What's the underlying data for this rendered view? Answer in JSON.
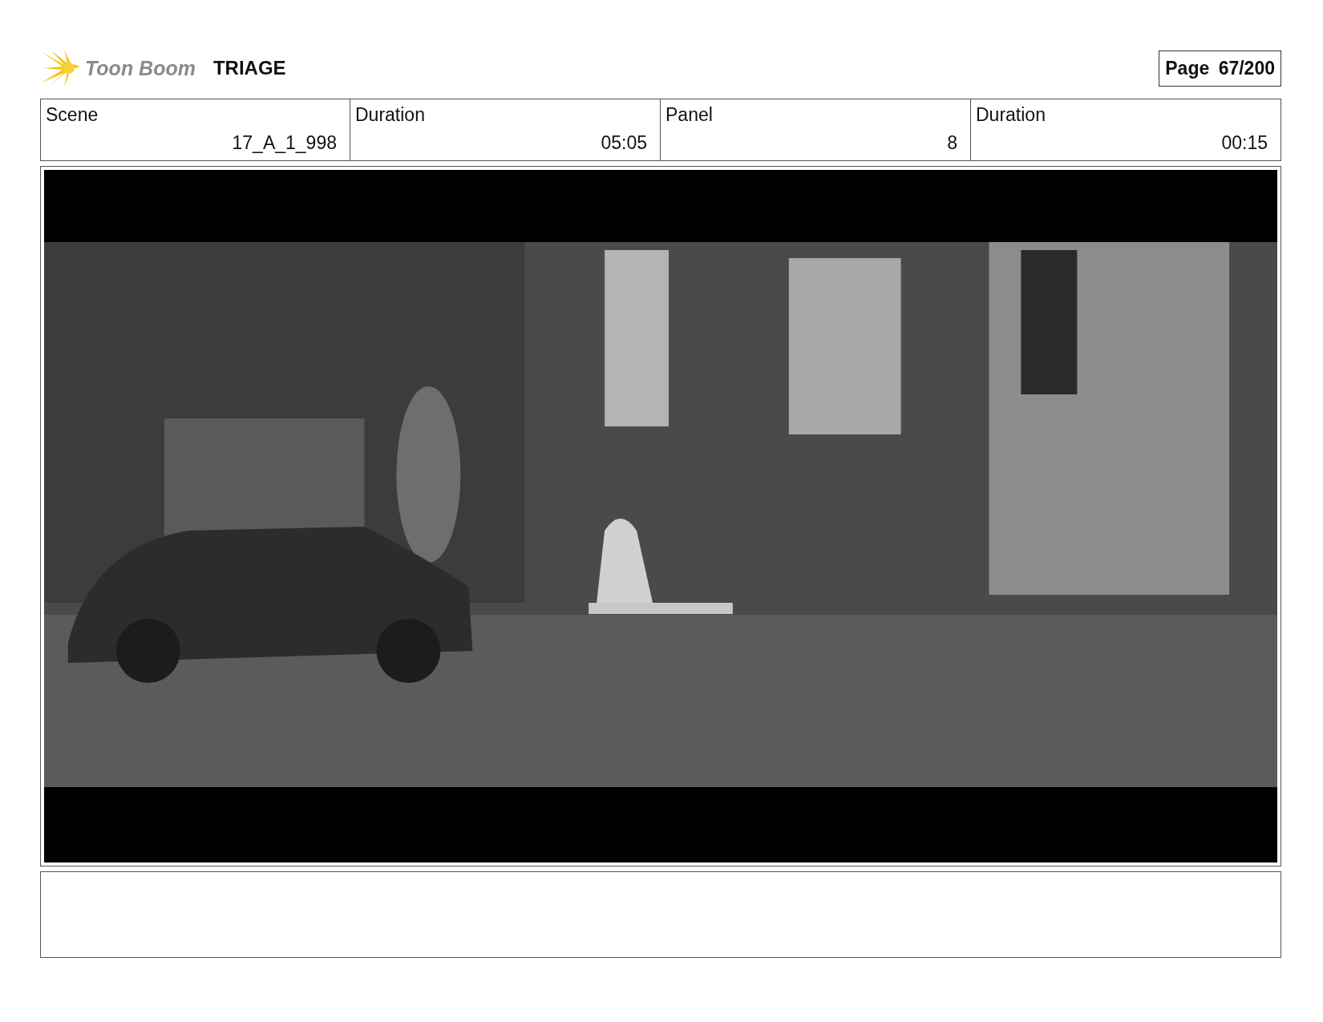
{
  "header": {
    "logo_text": "Toon Boom",
    "project_title": "TRIAGE",
    "page": "Page 67/200"
  },
  "info": [
    {
      "label": "Scene",
      "value": "17_A_1_998"
    },
    {
      "label": "Duration",
      "value": "05:05"
    },
    {
      "label": "Panel",
      "value": "8"
    },
    {
      "label": "Duration",
      "value": "00:15"
    }
  ]
}
